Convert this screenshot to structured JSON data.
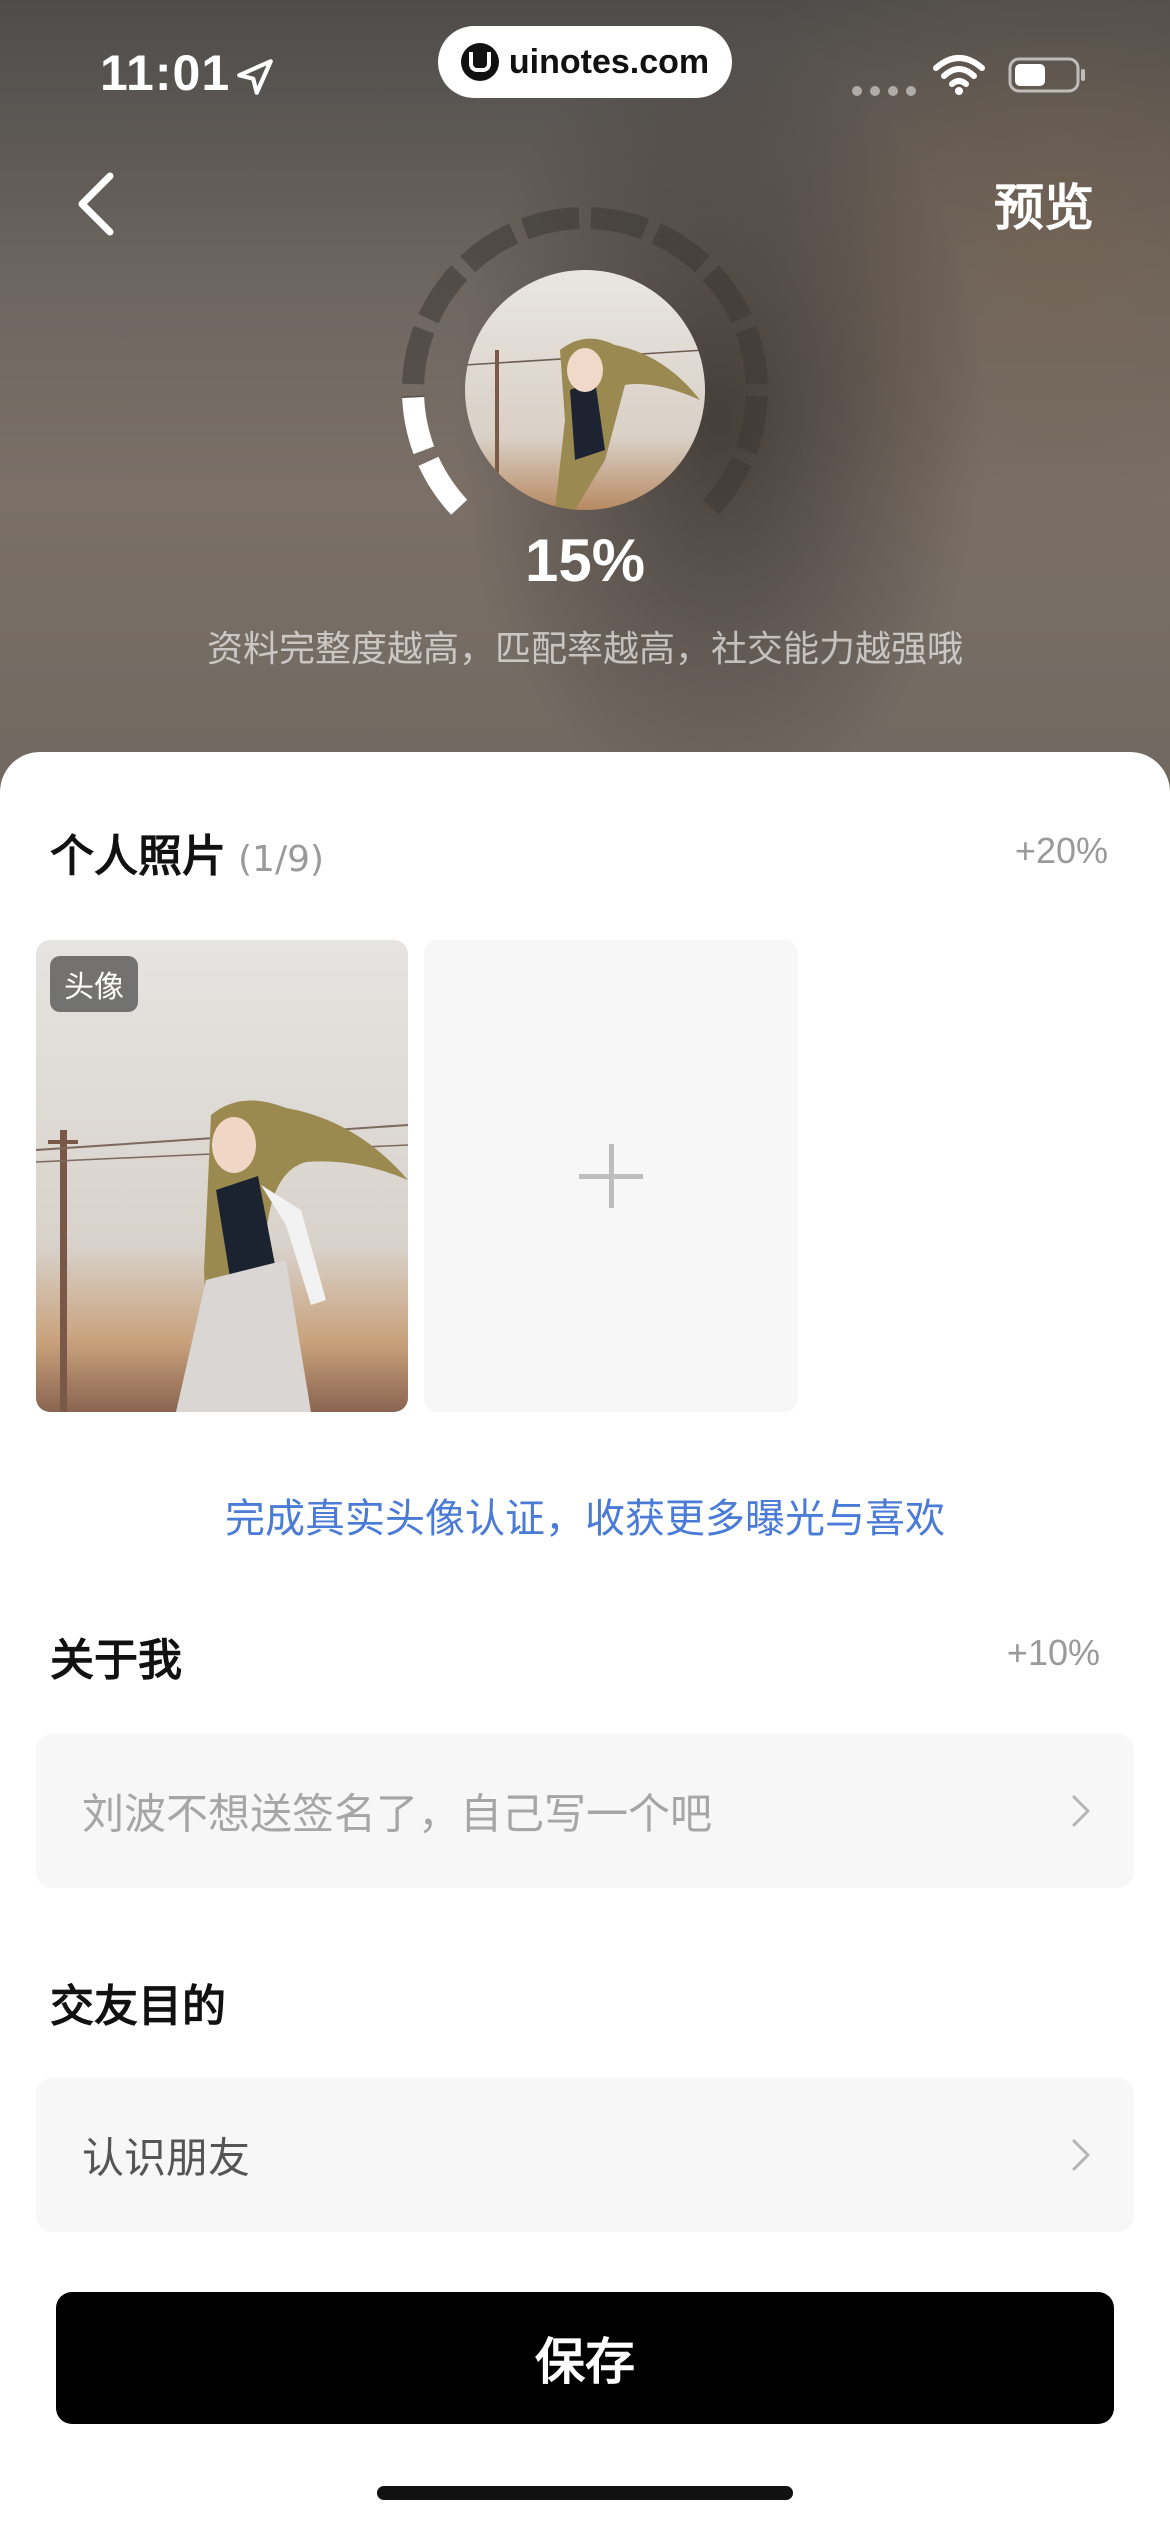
{
  "status_bar": {
    "time": "11:01",
    "url": "uinotes.com",
    "icons": [
      "location-arrow-icon",
      "signal-dots-icon",
      "wifi-icon",
      "battery-icon"
    ]
  },
  "nav": {
    "back_icon": "chevron-left-icon",
    "preview_label": "预览"
  },
  "profile_completion": {
    "percent_label": "15%",
    "percent_value": 15,
    "hint": "资料完整度越高，匹配率越高，社交能力越强哦"
  },
  "photos_section": {
    "title": "个人照片",
    "count": "(1/9)",
    "bonus": "+20%",
    "avatar_tag": "头像",
    "add_icon": "plus-icon"
  },
  "verify_link": "完成真实头像认证，收获更多曝光与喜欢",
  "about_section": {
    "title": "关于我",
    "bonus": "+10%",
    "placeholder": "刘波不想送签名了，自己写一个吧"
  },
  "purpose_section": {
    "title": "交友目的",
    "value": "认识朋友"
  },
  "save_label": "保存",
  "colors": {
    "accent_link": "#4a7bd6",
    "button_bg": "#000000",
    "field_bg": "#f7f7f7"
  }
}
